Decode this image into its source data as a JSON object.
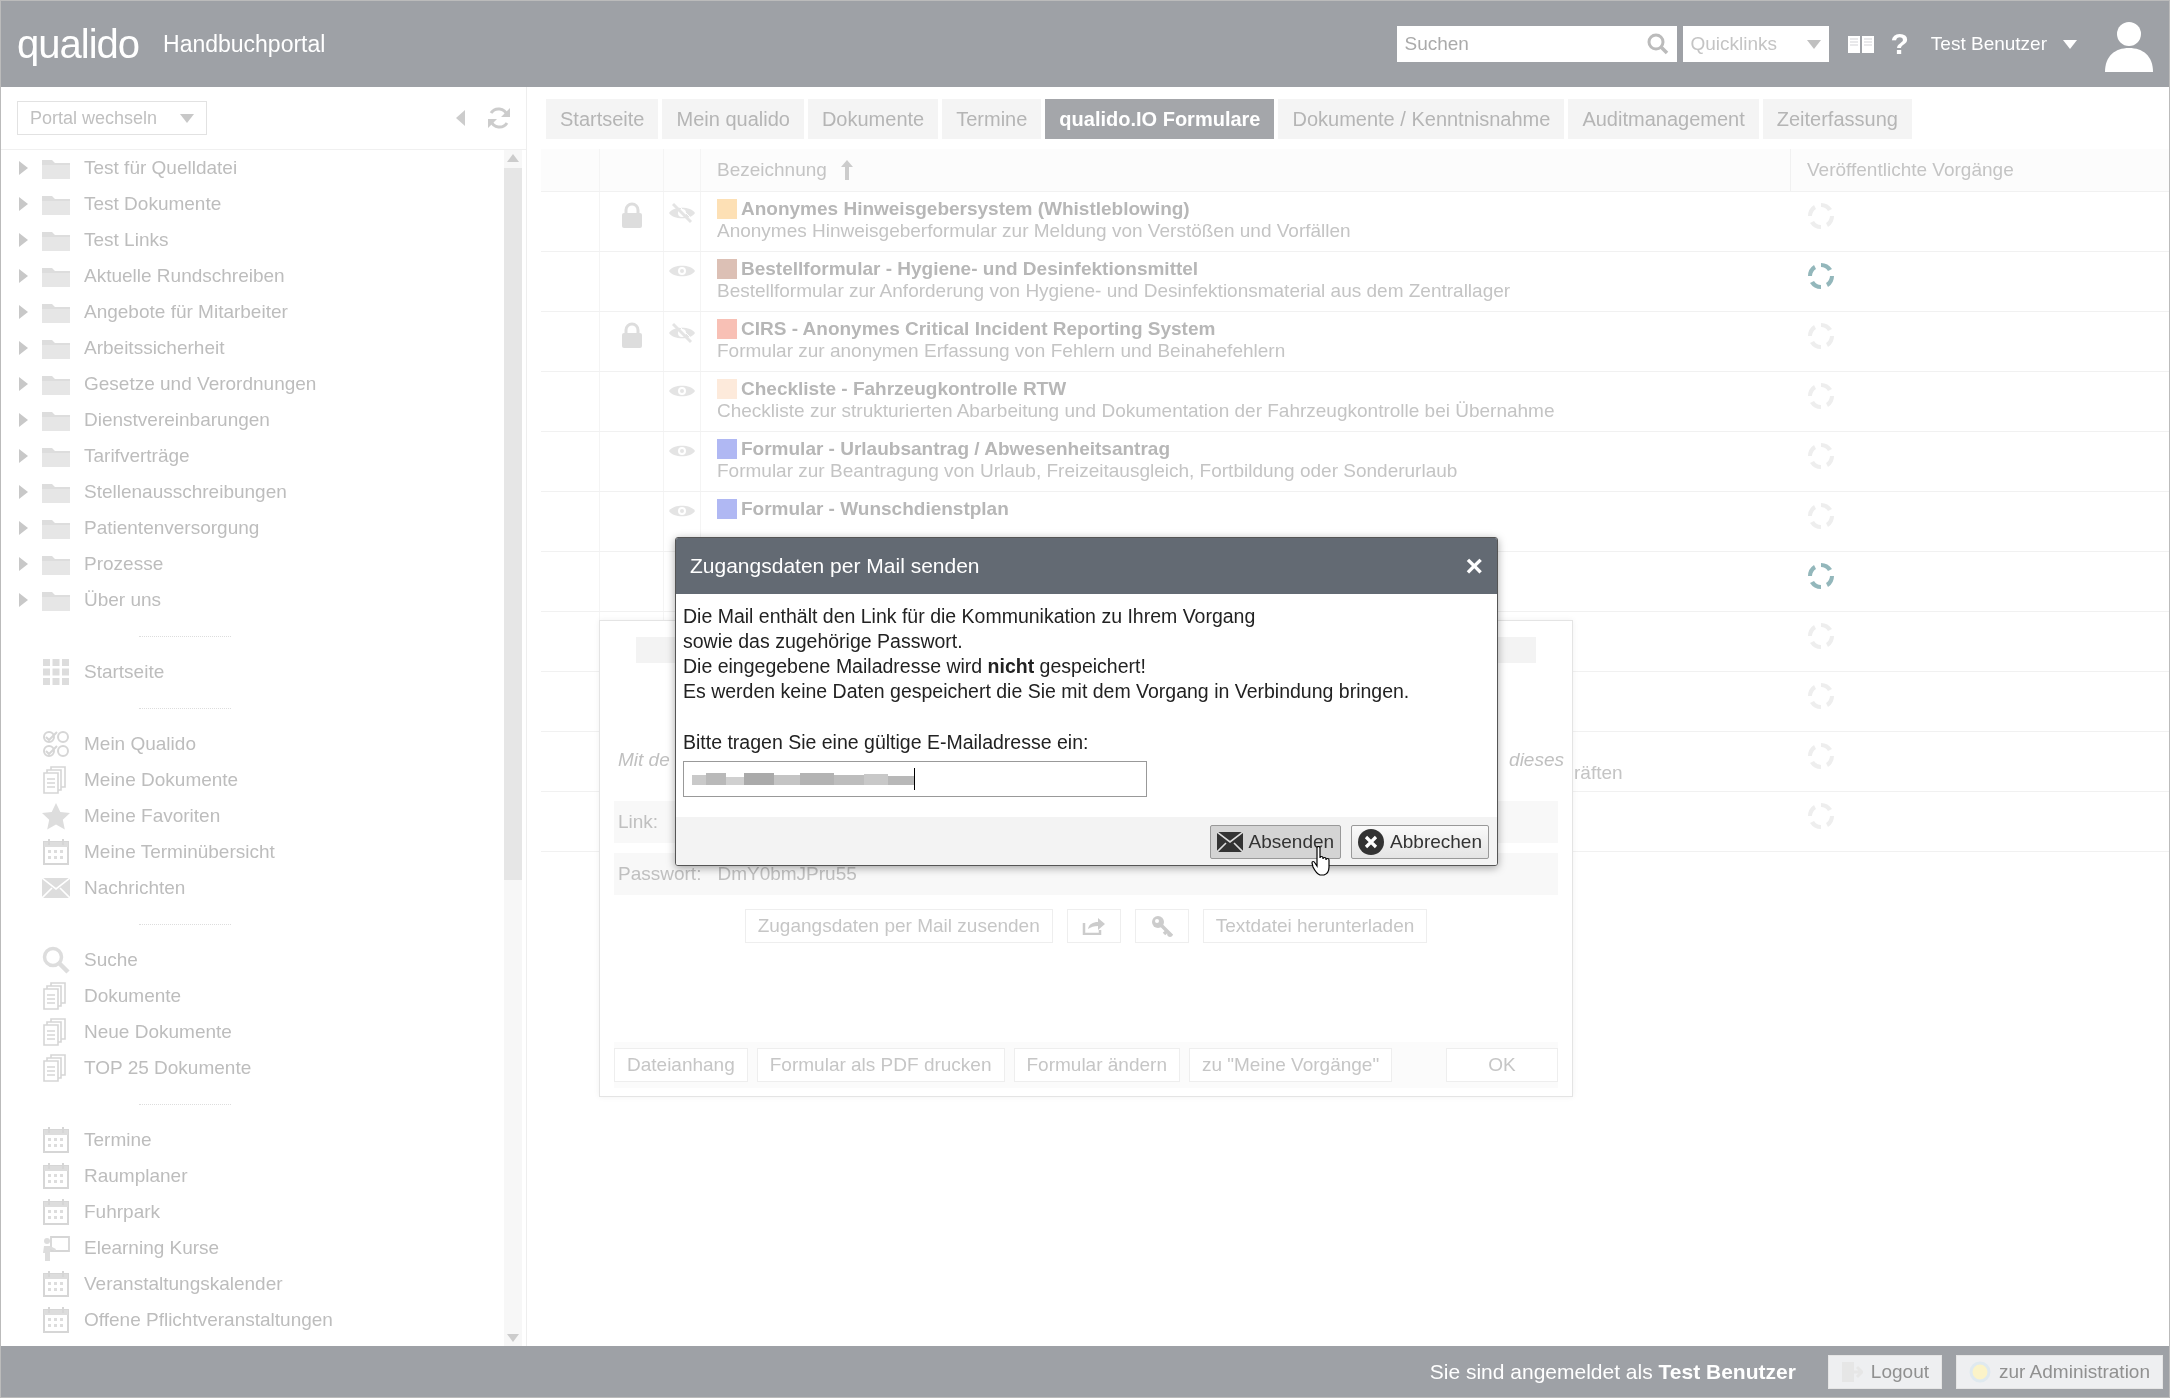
{
  "header": {
    "logo": "qualido",
    "portal_title": "Handbuchportal",
    "search": {
      "placeholder": "Suchen"
    },
    "quicklinks": "Quicklinks",
    "help": "?",
    "user": "Test Benutzer"
  },
  "sidebar": {
    "portal_switch": "Portal wechseln",
    "tree": [
      {
        "label": "Test für Quelldatei",
        "expanded": false
      },
      {
        "label": "Test Dokumente",
        "expanded": false
      },
      {
        "label": "Test Links",
        "expanded": false
      },
      {
        "label": "Aktuelle Rundschreiben",
        "expanded": false
      },
      {
        "label": "Angebote für Mitarbeiter",
        "expanded": false
      },
      {
        "label": "Arbeitssicherheit",
        "expanded": false
      },
      {
        "label": "Gesetze und Verordnungen",
        "expanded": false
      },
      {
        "label": "Dienstvereinbarungen",
        "expanded": false
      },
      {
        "label": "Tarifverträge",
        "expanded": false
      },
      {
        "label": "Stellenausschreibungen",
        "expanded": false
      },
      {
        "label": "Patientenversorgung",
        "expanded": false
      },
      {
        "label": "Prozesse",
        "expanded": false
      },
      {
        "label": "Über uns",
        "expanded": false
      }
    ],
    "sections": [
      [
        {
          "kind": "grid",
          "label": "Startseite"
        }
      ],
      [
        {
          "kind": "checks",
          "label": "Mein Qualido"
        },
        {
          "kind": "docs",
          "label": "Meine Dokumente"
        },
        {
          "kind": "star",
          "label": "Meine Favoriten"
        },
        {
          "kind": "calendar",
          "label": "Meine Terminübersicht"
        },
        {
          "kind": "mail",
          "label": "Nachrichten"
        }
      ],
      [
        {
          "kind": "search",
          "label": "Suche"
        },
        {
          "kind": "docs",
          "label": "Dokumente"
        },
        {
          "kind": "docs",
          "label": "Neue Dokumente"
        },
        {
          "kind": "docs",
          "label": "TOP 25 Dokumente"
        }
      ],
      [
        {
          "kind": "calendar",
          "label": "Termine"
        },
        {
          "kind": "calendar",
          "label": "Raumplaner"
        },
        {
          "kind": "calendar",
          "label": "Fuhrpark"
        },
        {
          "kind": "teacher",
          "label": "Elearning Kurse"
        },
        {
          "kind": "calendar",
          "label": "Veranstaltungskalender"
        },
        {
          "kind": "calendar",
          "label": "Offene Pflichtveranstaltungen"
        }
      ]
    ]
  },
  "tabs": [
    {
      "label": "Startseite",
      "selected": false
    },
    {
      "label": "Mein qualido",
      "selected": false
    },
    {
      "label": "Dokumente",
      "selected": false
    },
    {
      "label": "Termine",
      "selected": false
    },
    {
      "label": "qualido.IO Formulare",
      "selected": true
    },
    {
      "label": "Dokumente / Kenntnisnahme",
      "selected": false
    },
    {
      "label": "Auditmanagement",
      "selected": false
    },
    {
      "label": "Zeiterfassung",
      "selected": false
    }
  ],
  "table": {
    "columns": [
      "Bezeichnung",
      "Veröffentlichte Vorgänge"
    ],
    "rows": [
      {
        "title": "Anonymes Hinweisgebersystem (Whistleblowing)",
        "description": "Anonymes Hinweisgeberformular zur Meldung von Verstößen und Vorfällen",
        "color": "#fde0b5",
        "locked": true,
        "hidden": true,
        "active": false
      },
      {
        "title": "Bestellformular - Hygiene- und Desinfektionsmittel",
        "description": "Bestellformular zur Anforderung von Hygiene- und Desinfektionsmaterial aus dem Zentrallager",
        "color": "#dcc0b5",
        "locked": false,
        "hidden": false,
        "active": true
      },
      {
        "title": "CIRS - Anonymes Critical Incident Reporting System",
        "description": "Formular zur anonymen Erfassung von Fehlern und Beinahefehlern",
        "color": "#f8c0b5",
        "locked": true,
        "hidden": true,
        "active": false
      },
      {
        "title": "Checkliste - Fahrzeugkontrolle RTW",
        "description": "Checkliste zur strukturierten Abarbeitung und Dokumentation der Fahrzeugkontrolle bei Übernahme",
        "color": "#fdeadb",
        "locked": false,
        "hidden": false,
        "active": false
      },
      {
        "title": "Formular - Urlaubsantrag / Abwesenheitsantrag",
        "description": "Formular zur Beantragung von Urlaub, Freizeitausgleich, Fortbildung oder Sonderurlaub",
        "color": "#b0b8f3",
        "locked": false,
        "hidden": false,
        "active": false
      },
      {
        "title": "Formular - Wunschdienstplan",
        "color": "#b0b8f3",
        "locked": false,
        "hidden": false,
        "active": false
      }
    ],
    "covered_rows": [
      {
        "active": true
      },
      {
        "active": false
      },
      {
        "active": false
      },
      {
        "active": false,
        "fragment": "räften"
      },
      {
        "active": false
      }
    ]
  },
  "form_panel": {
    "notes": [
      "Mit de",
      "dieses"
    ],
    "link_label": "Link:",
    "password_label": "Passwort:",
    "password": "DmY0bmJPru55",
    "actions": [
      {
        "kind": "text",
        "label": "Zugangsdaten per Mail zusenden"
      },
      {
        "kind": "share"
      },
      {
        "kind": "key"
      },
      {
        "kind": "text",
        "label": "Textdatei herunterladen"
      }
    ],
    "footer_buttons": [
      "Dateianhang",
      "Formular als PDF drucken",
      "Formular ändern",
      "zu \"Meine Vorgänge\""
    ],
    "ok": "OK"
  },
  "mail_dialog": {
    "title": "Zugangsdaten per Mail senden",
    "close": "×",
    "lines": [
      "Die Mail enthält den Link für die Kommunikation zu Ihrem Vorgang",
      "sowie das zugehörige Passwort.",
      "Die eingegebene Mailadresse wird **nicht** gespeichert!",
      "Es werden keine Daten gespeichert die Sie mit dem Vorgang in Verbindung bringen."
    ],
    "prompt": "Bitte tragen Sie eine gültige E-Mailadresse ein:",
    "buttons": [
      {
        "kind": "send",
        "label": "Absenden"
      },
      {
        "kind": "cancel",
        "label": "Abbrechen"
      }
    ]
  },
  "status_bar": {
    "login_text": "Sie sind angemeldet als **Test Benutzer**",
    "logout": "Logout",
    "admin": "zur Administration"
  }
}
